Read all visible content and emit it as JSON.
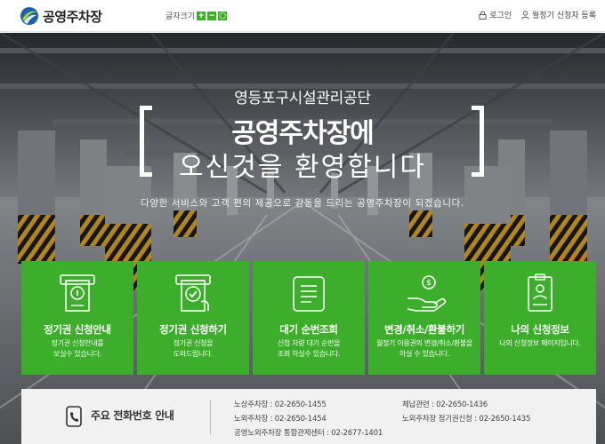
{
  "header": {
    "logo_text": "공영주차장",
    "font_size_label": "글자크기",
    "font_plus": "+",
    "font_minus": "−",
    "font_reset": "○",
    "login_label": "로그인",
    "register_label": "월정기 신청자 등록"
  },
  "hero": {
    "subtitle": "영등포구시설관리공단",
    "title_line1": "공영주차장에",
    "title_line2": "오신것을 환영합니다",
    "description": "다양한 서비스와 고객 편의 제공으로 감동을 드리는 공영주차장이 되겠습니다."
  },
  "cards": [
    {
      "title": "정기권 신청안내",
      "desc1": "정기권 신청안내를",
      "desc2": "보실수 있습니다.",
      "icon": "ticket-info-icon"
    },
    {
      "title": "정기권 신청하기",
      "desc1": "정기권 신청을",
      "desc2": "도와드립니다.",
      "icon": "ticket-apply-icon"
    },
    {
      "title": "대기 순번조회",
      "desc1": "신청 차량 대기 순번을",
      "desc2": "조회 하실수 있습니다.",
      "icon": "document-scroll-icon"
    },
    {
      "title": "변경/취소/환불하기",
      "desc1": "월정기 이용권의 변경/취소/환불을",
      "desc2": "하실 수 있습니다.",
      "icon": "hand-coin-icon"
    },
    {
      "title": "나의 신청정보",
      "desc1": "나의 신청정보 페이지입니다.",
      "desc2": "",
      "icon": "id-badge-icon"
    }
  ],
  "phone": {
    "title": "주요 전화번호 안내",
    "entries": [
      "노상주차장 : 02-2650-1455",
      "노외주차장 : 02-2650-1454",
      "공영노외주차장 통합관제센터 : 02-2677-1401",
      "체납관련 : 02-2650-1436",
      "노외주차장 정기권신청 : 02-2650-1435"
    ]
  },
  "colors": {
    "accent_green": "#3dae2b",
    "header_icon_green": "#3fae2a",
    "phone_box_bg": "#f1f1f1"
  }
}
